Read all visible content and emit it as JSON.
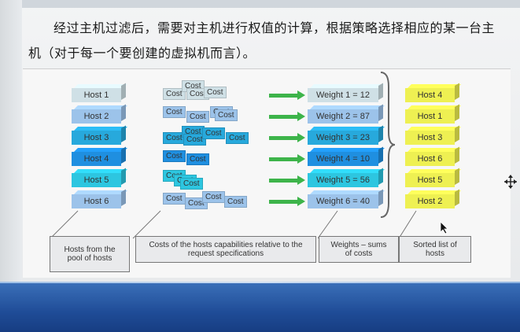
{
  "caption": {
    "text": "经过主机过滤后，需要对主机进行权值的计算，根据策略选择相应的某一台主机（对于每一个要创建的虚拟机而言）。"
  },
  "hosts": [
    {
      "label": "Host 1",
      "color": "#cfe0e6"
    },
    {
      "label": "Host 2",
      "color": "#9cc3ea"
    },
    {
      "label": "Host 3",
      "color": "#27a9dc"
    },
    {
      "label": "Host 4",
      "color": "#1f8fe0"
    },
    {
      "label": "Host 5",
      "color": "#2dc6e0"
    },
    {
      "label": "Host 6",
      "color": "#9cc3ea"
    }
  ],
  "cost_label": "Cost",
  "weights": [
    {
      "label": "Weight 1 = 12",
      "color": "#cfe0e6"
    },
    {
      "label": "Weight 2 = 87",
      "color": "#9cc3ea"
    },
    {
      "label": "Weight 3 = 23",
      "color": "#27a9dc"
    },
    {
      "label": "Weight 4 = 10",
      "color": "#1f8fe0"
    },
    {
      "label": "Weight 5 = 56",
      "color": "#2dc6e0"
    },
    {
      "label": "Weight 6 = 40",
      "color": "#9cc3ea"
    }
  ],
  "sorted": [
    {
      "label": "Host 4"
    },
    {
      "label": "Host 1"
    },
    {
      "label": "Host 3"
    },
    {
      "label": "Host 6"
    },
    {
      "label": "Host 5"
    },
    {
      "label": "Host 2"
    }
  ],
  "sorted_color": "#eef052",
  "arrow_color": "#3db44a",
  "notes": {
    "hosts": "Hosts from the pool of hosts",
    "costs": "Costs of the hosts capabilities relative to the request specifications",
    "weights": "Weights – sums of costs",
    "sorted": "Sorted list of hosts"
  }
}
